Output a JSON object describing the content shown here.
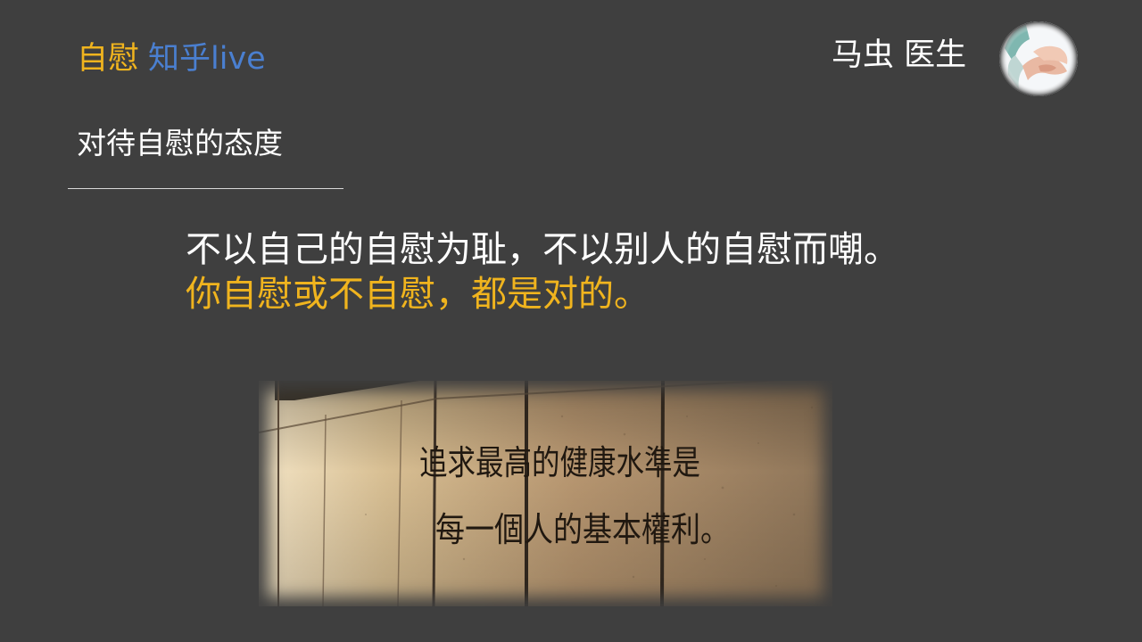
{
  "header": {
    "brand_primary": "自慰",
    "brand_secondary": "知乎live",
    "author": "马虫  医生"
  },
  "section": {
    "title": "对待自慰的态度"
  },
  "quote": {
    "line1": "不以自己的自慰为耻，不以别人的自慰而嘲。",
    "line2": "你自慰或不自慰，都是对的。"
  },
  "photo": {
    "caption_line1": "追求最高的健康水準是",
    "caption_line2": "每一個人的基本權利。"
  },
  "colors": {
    "background": "#3f3f3f",
    "accent_yellow": "#f0b41e",
    "accent_blue": "#4a7fd0",
    "text_white": "#ffffff"
  },
  "icons": {
    "avatar": "holding-hands-image"
  }
}
